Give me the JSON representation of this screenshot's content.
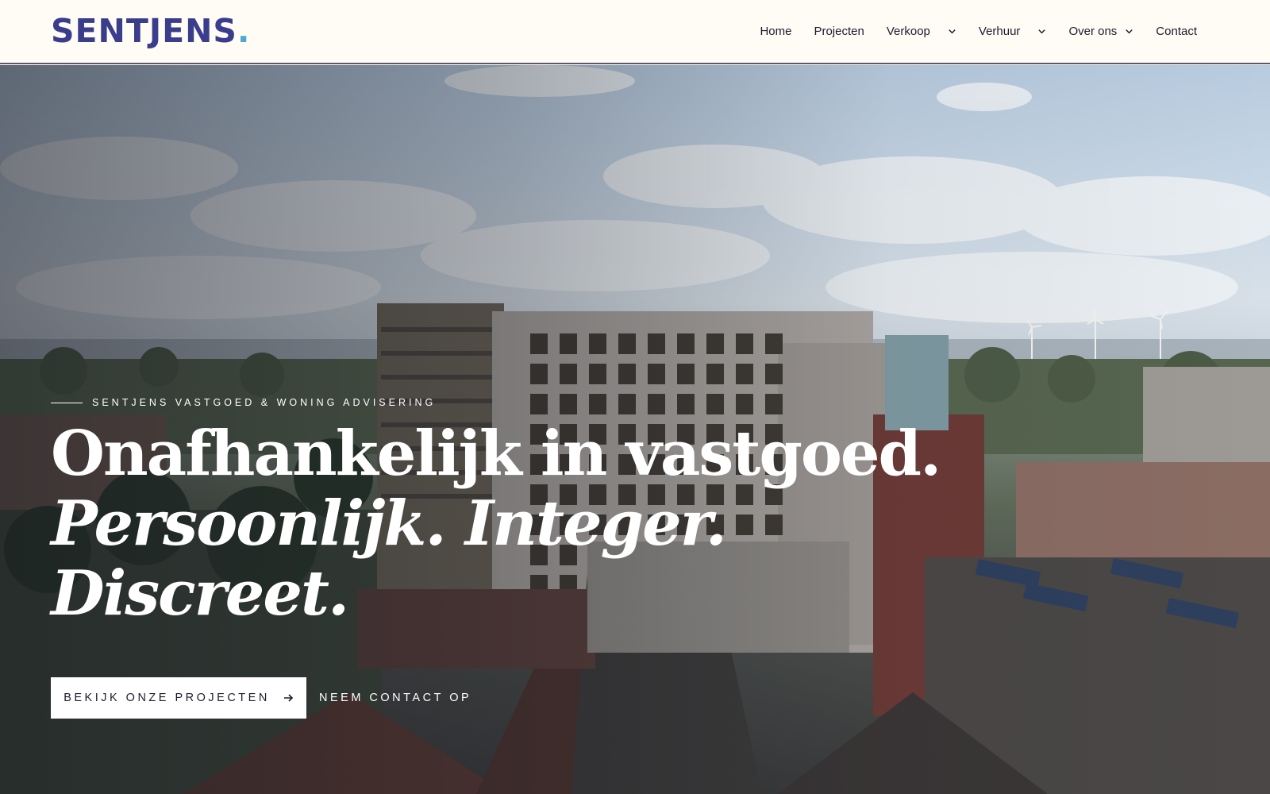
{
  "brand": {
    "name": "SENTJENS",
    "dot": ".",
    "colors": {
      "primary": "#3a3d8c",
      "accent": "#4fa8cf",
      "header_bg": "#fffbf5"
    }
  },
  "nav": {
    "items": [
      {
        "label": "Home",
        "has_dropdown": false
      },
      {
        "label": "Projecten",
        "has_dropdown": false
      },
      {
        "label": "Verkoop",
        "has_dropdown": true
      },
      {
        "label": "Verhuur",
        "has_dropdown": true
      },
      {
        "label": "Over ons",
        "has_dropdown": true
      },
      {
        "label": "Contact",
        "has_dropdown": false
      }
    ]
  },
  "hero": {
    "background": "aerial photo of town center with modern apartment building, clouds, wind turbines",
    "tagline": "SENTJENS VASTGOED & WONING ADVISERING",
    "headline_line1": "Onafhankelijk in vastgoed.",
    "headline_line2": "Persoonlijk. Integer.",
    "headline_line3": "Discreet.",
    "primary_cta": "BEKIJK ONZE PROJECTEN",
    "secondary_cta": "NEEM CONTACT OP",
    "icons": {
      "primary_cta": "arrow-right-icon",
      "dropdown": "chevron-down-icon"
    }
  }
}
